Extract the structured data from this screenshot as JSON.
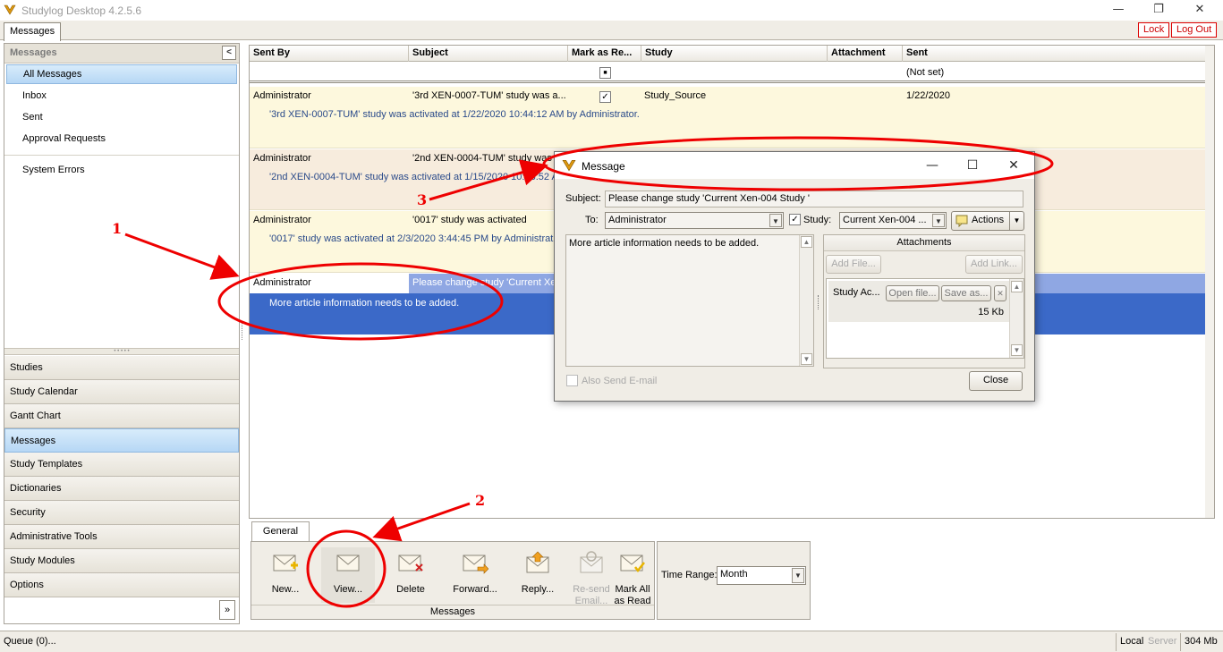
{
  "window": {
    "title": "Studylog Desktop 4.2.5.6",
    "minimize": "—",
    "restore": "❐",
    "close": "✕"
  },
  "main_tab": "Messages",
  "top_buttons": {
    "lock": "Lock",
    "logout": "Log Out"
  },
  "left_panel": {
    "header": "Messages",
    "collapse_glyph": "<",
    "items": [
      {
        "label": "All Messages",
        "selected": true
      },
      {
        "label": "Inbox"
      },
      {
        "label": "Sent"
      },
      {
        "label": "Approval Requests"
      }
    ],
    "system_errors": "System Errors",
    "modules": [
      "Studies",
      "Study Calendar",
      "Gantt Chart",
      "Messages",
      "Study Templates",
      "Dictionaries",
      "Security",
      "Administrative Tools",
      "Study Modules",
      "Options"
    ],
    "selected_module": "Messages",
    "expand_glyph": "»"
  },
  "grid": {
    "columns": [
      "Sent By",
      "Subject",
      "Mark as Re...",
      "Study",
      "Attachment",
      "Sent"
    ],
    "filter_sent": "(Not set)",
    "rows": [
      {
        "sent_by": "Administrator",
        "subject": "'3rd XEN-0007-TUM' study was a...",
        "mark_read": true,
        "study": "Study_Source",
        "sent": "1/22/2020",
        "preview": "'3rd XEN-0007-TUM' study was activated at 1/22/2020 10:44:12 AM by Administrator."
      },
      {
        "sent_by": "Administrator",
        "subject": "'2nd XEN-0004-TUM' study was",
        "mark_read": false,
        "study": "",
        "sent": "",
        "preview": "'2nd XEN-0004-TUM' study was activated at 1/15/2020 10:03:52 A"
      },
      {
        "sent_by": "Administrator",
        "subject": "'0017' study was activated",
        "mark_read": false,
        "study": "",
        "sent": "",
        "preview": "'0017' study was activated at 2/3/2020 3:44:45 PM by Administrat"
      },
      {
        "sent_by": "Administrator",
        "subject": "Please change study 'Current Xe...",
        "mark_read": false,
        "study": "",
        "sent": "",
        "preview": "More article information needs to be added."
      }
    ]
  },
  "ribbon": {
    "tab": "General",
    "group_label": "Messages",
    "buttons": [
      {
        "label1": "New...",
        "label2": ""
      },
      {
        "label1": "View...",
        "label2": ""
      },
      {
        "label1": "Delete",
        "label2": ""
      },
      {
        "label1": "Forward...",
        "label2": ""
      },
      {
        "label1": "Reply...",
        "label2": ""
      },
      {
        "label1": "Re-send",
        "label2": "Email..."
      },
      {
        "label1": "Mark All",
        "label2": "as Read"
      }
    ],
    "time_range_label": "Time Range:",
    "time_range_value": "Month"
  },
  "status": {
    "queue": "Queue (0)...",
    "local": "Local",
    "server": "Server",
    "memory": "304 Mb"
  },
  "dialog": {
    "title": "Message",
    "subject_label": "Subject:",
    "subject_value": "Please change study 'Current Xen-004  Study '",
    "to_label": "To:",
    "to_value": "Administrator",
    "study_label": "Study:",
    "study_value": "Current Xen-004 ...",
    "actions_label": "Actions",
    "body": "More article information needs to be added.",
    "attachments_header": "Attachments",
    "add_file": "Add File...",
    "add_link": "Add Link...",
    "attachment_name": "Study Ac...",
    "open_file": "Open file...",
    "save_as": "Save as...",
    "attachment_remove": "✕",
    "attachment_size": "15 Kb",
    "also_send_email": "Also Send E-mail",
    "close_button": "Close"
  },
  "annotations": {
    "n1": "1",
    "n2": "2",
    "n3": "3"
  },
  "colors": {
    "accent_red": "#e00000",
    "row_yellow": "#fdf8dd",
    "row_beige": "#f7ecdd",
    "row_selected": "#3b69c8",
    "selection_blue": "#b6d7f5"
  }
}
